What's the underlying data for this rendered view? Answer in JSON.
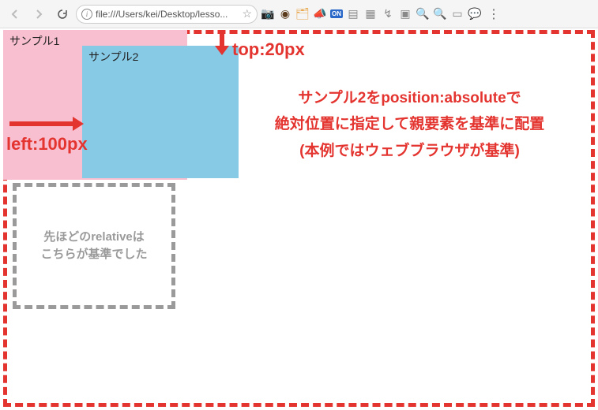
{
  "chrome": {
    "url": "file:///Users/kei/Desktop/lesso...",
    "icons": {
      "camera": "📷",
      "dark": "◉",
      "folder": "🗂",
      "megaphone": "📣",
      "on": "ON",
      "page": "▤",
      "grid": "▦",
      "arrow": "↯",
      "cube": "▣",
      "zoom_in": "🔍",
      "zoom_out": "🔍",
      "copy": "▭",
      "chat": "💬"
    }
  },
  "sample1": {
    "label": "サンプル1"
  },
  "sample2": {
    "label": "サンプル2"
  },
  "annotations": {
    "top": "top:20px",
    "left": "left:100px",
    "desc_line1": "サンプル2をposition:absoluteで",
    "desc_line2": "絶対位置に指定して親要素を基準に配置",
    "desc_line3": "(本例ではウェブブラウザが基準)"
  },
  "relative_box": {
    "line1": "先ほどのrelativeは",
    "line2": "こちらが基準でした"
  }
}
